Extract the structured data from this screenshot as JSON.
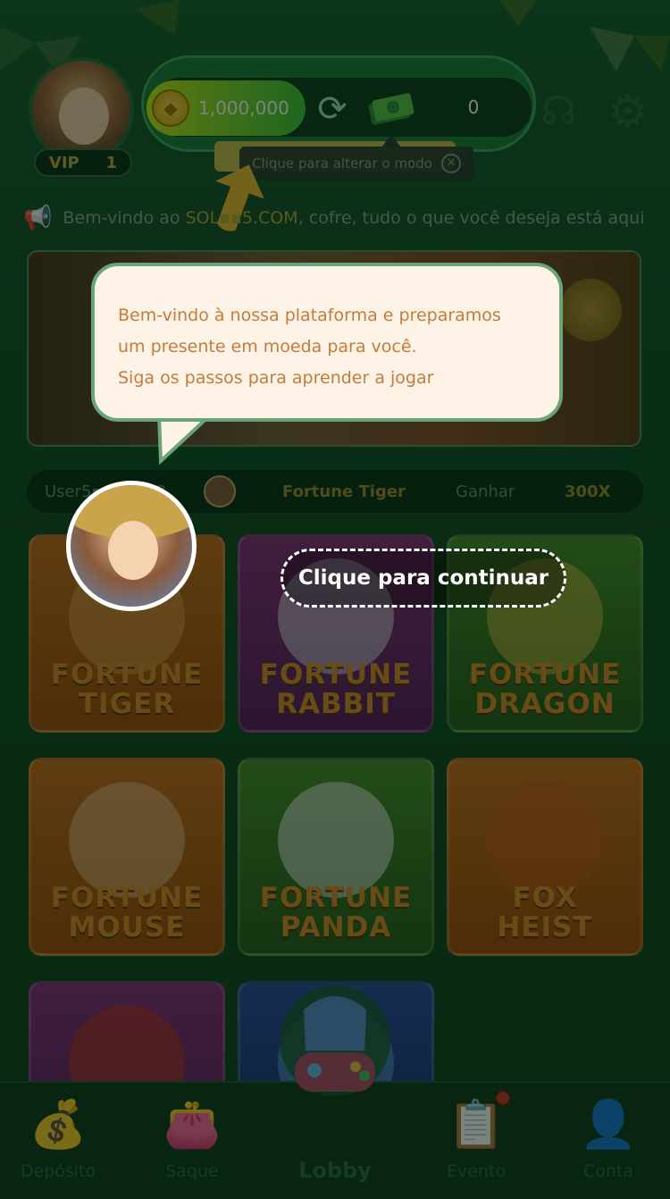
{
  "header": {
    "vip_label": "VIP",
    "vip_level": "1",
    "coin_balance": "1,000,000",
    "cash_balance": "0",
    "tooltip": "Clique para alterar o modo",
    "icons": {
      "coin": "coin-icon",
      "swap": "refresh-icon",
      "cash": "money-stack-icon",
      "support": "headset-icon",
      "settings": "gear-icon",
      "tooltip_close": "close-icon"
    }
  },
  "marquee": {
    "prefix": "Bem-vindo ao ",
    "site": "SOL▪▪5.COM",
    "suffix": ", cofre, tudo o que você deseja está aqui"
  },
  "tutorial": {
    "line1": "Bem-vindo à nossa plataforma e preparamos",
    "line2": "um presente em moeda para você.",
    "line3": "Siga os passos para aprender a jogar",
    "continue_label": "Clique para continuar"
  },
  "ticker": {
    "user": "User5▪▪▪▪▪32",
    "game": "Fortune Tiger",
    "win_label": "Ganhar",
    "multiplier": "300X"
  },
  "games": [
    {
      "line1": "FORTUNE",
      "line2": "TIGER"
    },
    {
      "line1": "FORTUNE",
      "line2": "RABBIT"
    },
    {
      "line1": "FORTUNE",
      "line2": "DRAGON"
    },
    {
      "line1": "FORTUNE",
      "line2": "MOUSE"
    },
    {
      "line1": "FORTUNE",
      "line2": "PANDA"
    },
    {
      "line1": "FOX",
      "line2": "HEIST"
    },
    {
      "line1": "",
      "line2": ""
    },
    {
      "line1": "",
      "line2": ""
    }
  ],
  "nav": {
    "deposit": "Depósito",
    "withdraw": "Saque",
    "lobby": "Lobby",
    "event": "Evento",
    "account": "Conta"
  },
  "colors": {
    "accent_green": "#1f7a3a",
    "bubble_text": "#c97a3a",
    "bubble_bg": "#fdf3e6",
    "tile_text": "#d98a2a"
  }
}
